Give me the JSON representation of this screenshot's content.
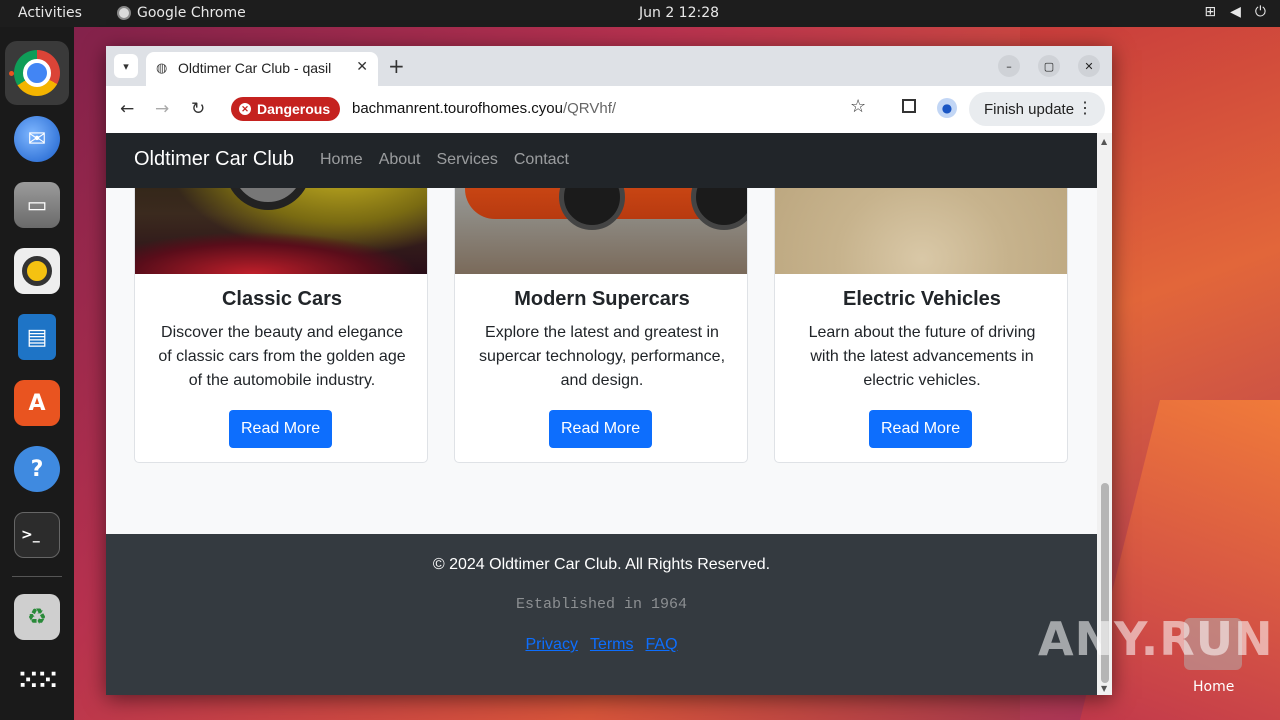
{
  "topbar": {
    "activities": "Activities",
    "app_name": "Google Chrome",
    "clock": "Jun 2  12:28"
  },
  "dock": {
    "items": [
      "chrome-icon",
      "thunderbird-icon",
      "files-icon",
      "rhythmbox-icon",
      "writer-icon",
      "app-center-icon",
      "help-icon",
      "terminal-icon",
      "trash-icon",
      "app-grid-icon"
    ]
  },
  "browser": {
    "tab_title": "Oldtimer Car Club - qasil",
    "danger_label": "Dangerous",
    "url_host": "bachmanrent.tourofhomes.cyou",
    "url_path": "/QRVhf/",
    "finish_update": "Finish update"
  },
  "site": {
    "brand": "Oldtimer Car Club",
    "nav": [
      "Home",
      "About",
      "Services",
      "Contact"
    ],
    "cards": [
      {
        "title": "Classic Cars",
        "text": "Discover the beauty and elegance of classic cars from the golden age of the automobile industry.",
        "button": "Read More"
      },
      {
        "title": "Modern Supercars",
        "text": "Explore the latest and greatest in supercar technology, performance, and design.",
        "button": "Read More"
      },
      {
        "title": "Electric Vehicles",
        "text": "Learn about the future of driving with the latest advancements in electric vehicles.",
        "button": "Read More"
      }
    ],
    "footer": {
      "copyright": "© 2024 Oldtimer Car Club. All Rights Reserved.",
      "established": "Established in 1964",
      "links": [
        "Privacy",
        "Terms",
        "FAQ"
      ]
    }
  },
  "desktop": {
    "watermark": "ANY.RUN",
    "home_label": "Home"
  },
  "colors": {
    "accent_button": "#0d6efd",
    "navbar_bg": "#212529",
    "footer_bg": "#343a40",
    "danger_badge": "#c5221f"
  }
}
